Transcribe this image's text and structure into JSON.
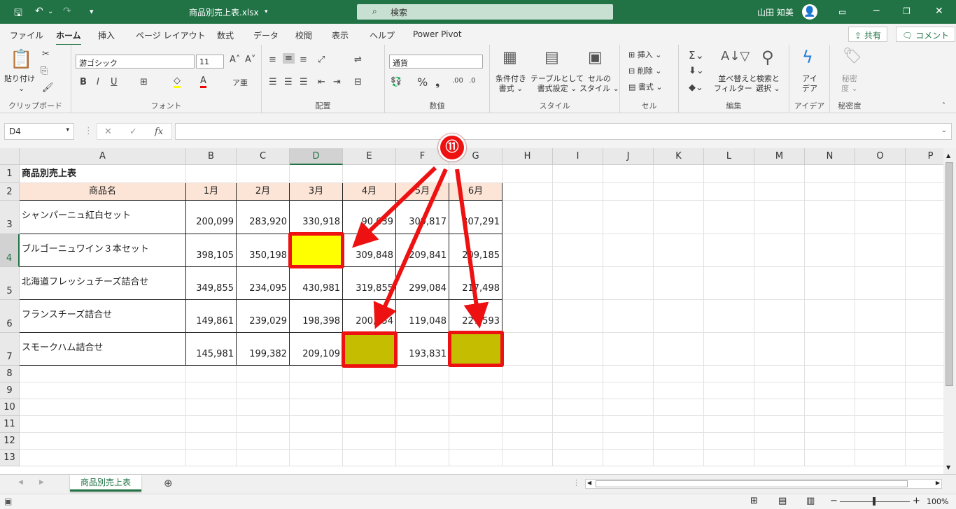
{
  "titlebar": {
    "filename": "商品別売上表.xlsx",
    "search_placeholder": "検索",
    "user_name": "山田 知美"
  },
  "tabs": [
    "ファイル",
    "ホーム",
    "挿入",
    "ページ レイアウト",
    "数式",
    "データ",
    "校閲",
    "表示",
    "ヘルプ",
    "Power Pivot"
  ],
  "active_tab": "ホーム",
  "share_label": "共有",
  "comment_label": "コメント",
  "ribbon": {
    "clipboard": {
      "paste": "貼り付け",
      "label": "クリップボード"
    },
    "font": {
      "name": "游ゴシック",
      "size": "11",
      "label": "フォント"
    },
    "alignment": {
      "label": "配置"
    },
    "number": {
      "format": "通貨",
      "label": "数値"
    },
    "styles": {
      "conditional": "条件付き",
      "conditional2": "書式",
      "table": "テーブルとして",
      "table2": "書式設定",
      "cell": "セルの",
      "cell2": "スタイル",
      "label": "スタイル"
    },
    "cells": {
      "insert": "挿入",
      "delete": "削除",
      "format": "書式",
      "label": "セル"
    },
    "editing": {
      "sort": "並べ替えと",
      "sort2": "フィルター",
      "find": "検索と",
      "find2": "選択",
      "label": "編集"
    },
    "ideas": {
      "top": "アイ",
      "bottom": "デア",
      "label": "アイデア"
    },
    "sensitivity": {
      "top": "秘密",
      "bottom": "度",
      "label": "秘密度"
    }
  },
  "formula_bar": {
    "name_box": "D4",
    "fx": "fx",
    "cancel": "✕",
    "enter": "✓"
  },
  "columns": [
    "A",
    "B",
    "C",
    "D",
    "E",
    "F",
    "G",
    "H",
    "I",
    "J",
    "K",
    "L",
    "M",
    "N",
    "O",
    "P"
  ],
  "rows": [
    "1",
    "2",
    "3",
    "4",
    "5",
    "6",
    "7",
    "8",
    "9",
    "10",
    "11",
    "12",
    "13"
  ],
  "sheet": {
    "title": "商品別売上表",
    "headers": [
      "商品名",
      "1月",
      "2月",
      "3月",
      "4月",
      "5月",
      "6月"
    ],
    "data": [
      [
        "シャンパーニュ紅白セット",
        "200,099",
        "283,920",
        "330,918",
        "90,639",
        "309,817",
        "307,291"
      ],
      [
        "ブルゴーニュワイン３本セット",
        "398,105",
        "350,198",
        "",
        "309,848",
        "209,841",
        "209,185"
      ],
      [
        "北海道フレッシュチーズ詰合せ",
        "349,855",
        "234,095",
        "430,981",
        "319,855",
        "299,084",
        "217,498"
      ],
      [
        "フランスチーズ詰合せ",
        "149,861",
        "239,029",
        "198,398",
        "200,054",
        "119,048",
        "227,593"
      ],
      [
        "スモークハム詰合せ",
        "145,981",
        "199,382",
        "209,109",
        "",
        "193,831",
        ""
      ]
    ],
    "fill_yellow": "#ffff00",
    "fill_olive": "#c4bd00"
  },
  "sheet_tab": "商品別売上表",
  "annotation": {
    "marker": "⑪",
    "color": "#ee1111"
  },
  "zoom": "100%"
}
